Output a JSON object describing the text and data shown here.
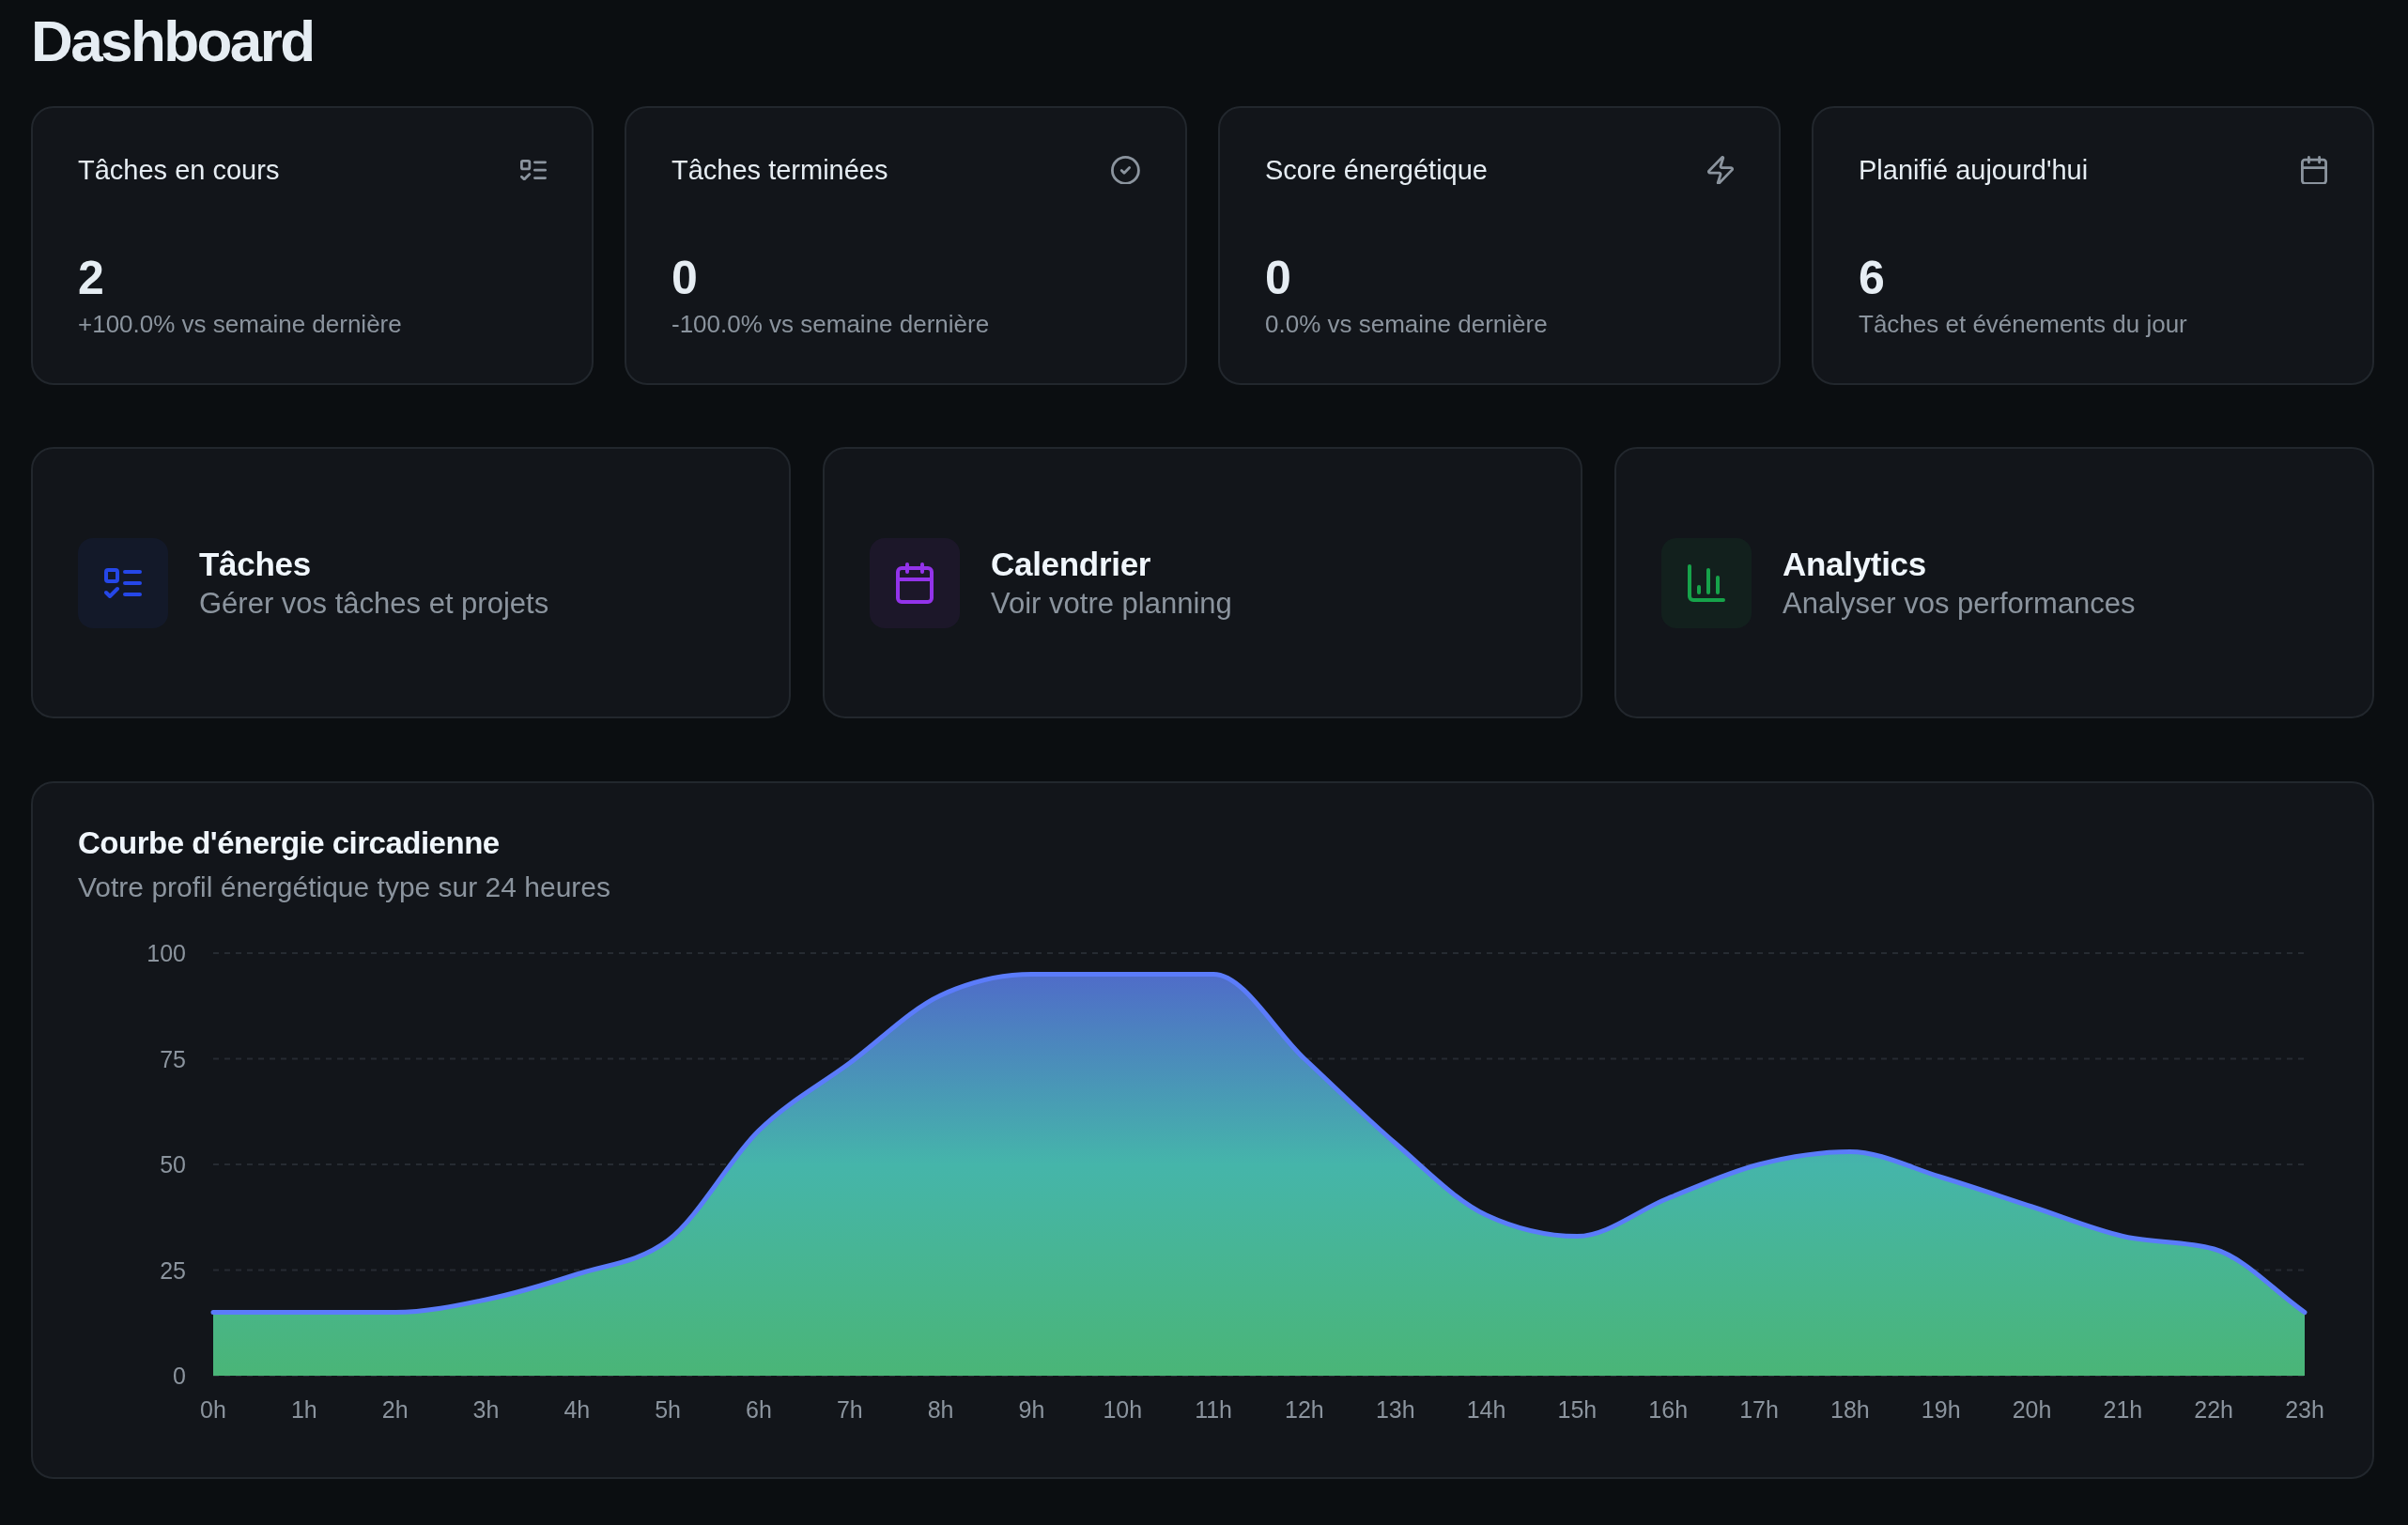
{
  "page": {
    "title": "Dashboard"
  },
  "stat_cards": [
    {
      "kind": "tasks",
      "title": "Tâches en cours",
      "value": "2",
      "note": "+100.0% vs semaine dernière"
    },
    {
      "kind": "done",
      "title": "Tâches terminées",
      "value": "0",
      "note": "-100.0% vs semaine dernière"
    },
    {
      "kind": "energy",
      "title": "Score énergétique",
      "value": "0",
      "note": "0.0% vs semaine dernière"
    },
    {
      "kind": "schedule",
      "title": "Planifié aujourd'hui",
      "value": "6",
      "note": "Tâches et événements du jour"
    }
  ],
  "nav_cards": [
    {
      "kind": "tasks",
      "color": "#2547e8",
      "title": "Tâches",
      "description": "Gérer vos tâches et projets"
    },
    {
      "kind": "calendar",
      "color": "#9333ea",
      "title": "Calendrier",
      "description": "Voir votre planning"
    },
    {
      "kind": "analytics",
      "color": "#16a34a",
      "title": "Analytics",
      "description": "Analyser vos performances"
    }
  ],
  "chart_card": {
    "title": "Courbe d'énergie circadienne",
    "subtitle": "Votre profil énergétique type sur 24 heures",
    "chart_data": {
      "type": "area",
      "categories": [
        "0h",
        "1h",
        "2h",
        "3h",
        "4h",
        "5h",
        "6h",
        "7h",
        "8h",
        "9h",
        "10h",
        "11h",
        "12h",
        "13h",
        "14h",
        "15h",
        "16h",
        "17h",
        "18h",
        "19h",
        "20h",
        "21h",
        "22h",
        "23h"
      ],
      "ylim": [
        0,
        100
      ],
      "yticks": [
        0,
        25,
        50,
        75,
        100
      ],
      "grid": true,
      "series": [
        {
          "color": "#5b7cfa",
          "values": [
            15,
            15,
            15,
            18,
            24,
            32,
            58,
            74,
            90,
            95,
            95,
            95,
            75,
            55,
            38,
            33,
            42,
            50,
            53,
            47,
            40,
            33,
            30,
            15
          ]
        }
      ]
    }
  }
}
